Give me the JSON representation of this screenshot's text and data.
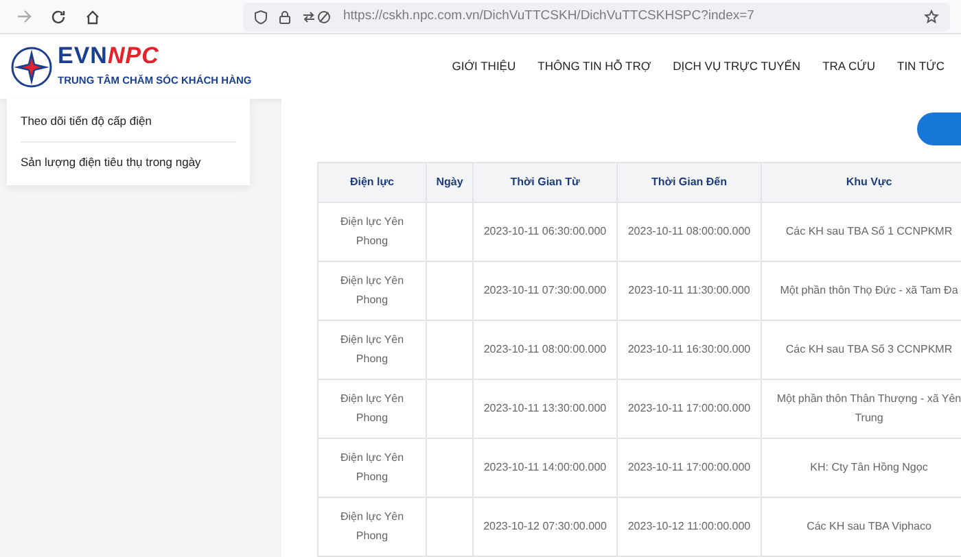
{
  "browser": {
    "url": "https://cskh.npc.com.vn/DichVuTTCSKH/DichVuTTCSKHSPC?index=7"
  },
  "header": {
    "logo_brand": [
      "EVN",
      "NPC"
    ],
    "logo_subtitle": "TRUNG TÂM CHĂM SÓC KHÁCH HÀNG",
    "nav": [
      "GIỚI THIỆU",
      "THÔNG TIN HỖ TRỢ",
      "DỊCH VỤ TRỰC TUYẾN",
      "TRA CỨU",
      "TIN TỨC"
    ]
  },
  "sidebar": {
    "items": [
      "Theo dõi tiến độ cấp điện",
      "Sản lượng điện tiêu thụ trong ngày"
    ]
  },
  "table": {
    "columns": [
      "Điện lực",
      "Ngày",
      "Thời Gian Từ",
      "Thời Gian Đến",
      "Khu Vực"
    ],
    "rows": [
      [
        "Điện lực Yên Phong",
        "",
        "2023-10-11 06:30:00.000",
        "2023-10-11 08:00:00.000",
        "Các KH sau TBA Số 1 CCNPKMR"
      ],
      [
        "Điện lực Yên Phong",
        "",
        "2023-10-11 07:30:00.000",
        "2023-10-11 11:30:00.000",
        "Một phần thôn Thọ Đức - xã Tam Đa"
      ],
      [
        "Điện lực Yên Phong",
        "",
        "2023-10-11 08:00:00.000",
        "2023-10-11 16:30:00.000",
        "Các KH sau TBA Số 3 CCNPKMR"
      ],
      [
        "Điện lực Yên Phong",
        "",
        "2023-10-11 13:30:00.000",
        "2023-10-11 17:00:00.000",
        "Một phần thôn Thân Thượng - xã Yên Trung"
      ],
      [
        "Điện lực Yên Phong",
        "",
        "2023-10-11 14:00:00.000",
        "2023-10-11 17:00:00.000",
        "KH: Cty Tân Hồng Ngọc"
      ],
      [
        "Điện lực Yên Phong",
        "",
        "2023-10-12 07:30:00.000",
        "2023-10-12 11:00:00.000",
        "Các KH sau TBA Viphaco"
      ]
    ]
  }
}
